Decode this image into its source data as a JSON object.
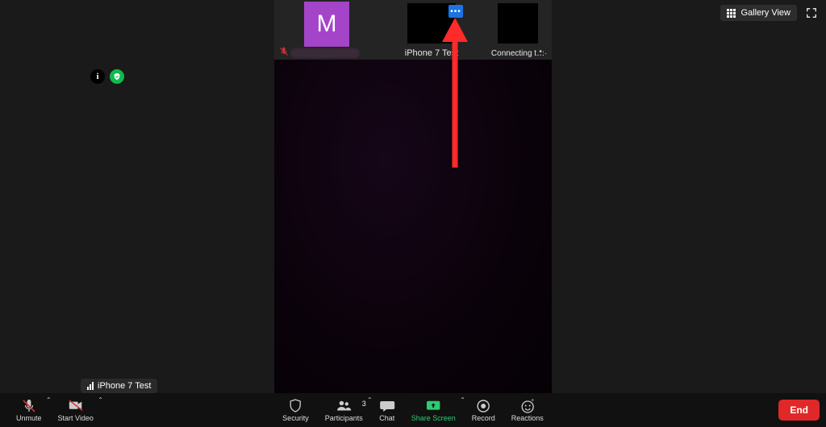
{
  "view_button_label": "Gallery View",
  "participants_strip": {
    "tile1": {
      "avatar_initial": "M",
      "muted": true
    },
    "tile2": {
      "label": "iPhone 7 Test"
    },
    "tile3": {
      "label": "Connecting t…"
    }
  },
  "audio_source_tooltip": "iPhone 7 Test",
  "toolbar": {
    "unmute": "Unmute",
    "start_video": "Start Video",
    "security": "Security",
    "participants": "Participants",
    "participants_count": "3",
    "chat": "Chat",
    "share_screen": "Share Screen",
    "record": "Record",
    "reactions": "Reactions",
    "end": "End"
  },
  "colors": {
    "accent_green": "#2ecc71",
    "end_red": "#e02828",
    "avatar_purple": "#a444c9",
    "ellipsis_blue": "#1b74e4"
  },
  "annotation": {
    "type": "arrow",
    "points_to": "blue-ellipsis-button"
  }
}
